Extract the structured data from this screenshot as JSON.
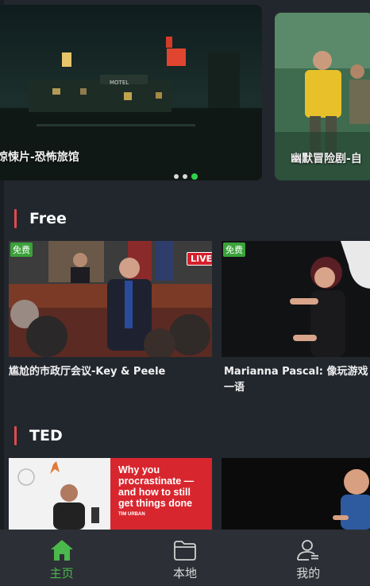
{
  "banners": [
    {
      "caption": "惊悚片-恐怖旅馆"
    },
    {
      "caption": "幽默冒险剧-自"
    }
  ],
  "carousel": {
    "dot_count": 3,
    "active_index": 2
  },
  "sections": [
    {
      "title": "Free"
    },
    {
      "title": "TED"
    }
  ],
  "free_cards": [
    {
      "badge": "免费",
      "title": "尴尬的市政厅会议-Key & Peele",
      "live_label": "LIVE"
    },
    {
      "badge": "免费",
      "title": "Marianna Pascal: 像玩游戏一语"
    }
  ],
  "ted_cards": [
    {
      "thumb_text": [
        "Why you",
        "procrastinate —",
        "and how to still",
        "get things done"
      ],
      "byline": "TIM URBAN"
    },
    {}
  ],
  "nav": [
    {
      "label": "主页",
      "icon": "home-icon",
      "active": true
    },
    {
      "label": "本地",
      "icon": "folder-icon",
      "active": false
    },
    {
      "label": "我的",
      "icon": "profile-icon",
      "active": false
    }
  ],
  "colors": {
    "accent": "#4bb84b",
    "section_bar": "#e14b4b",
    "free_badge": "#3aa23a",
    "background": "#22272e"
  }
}
